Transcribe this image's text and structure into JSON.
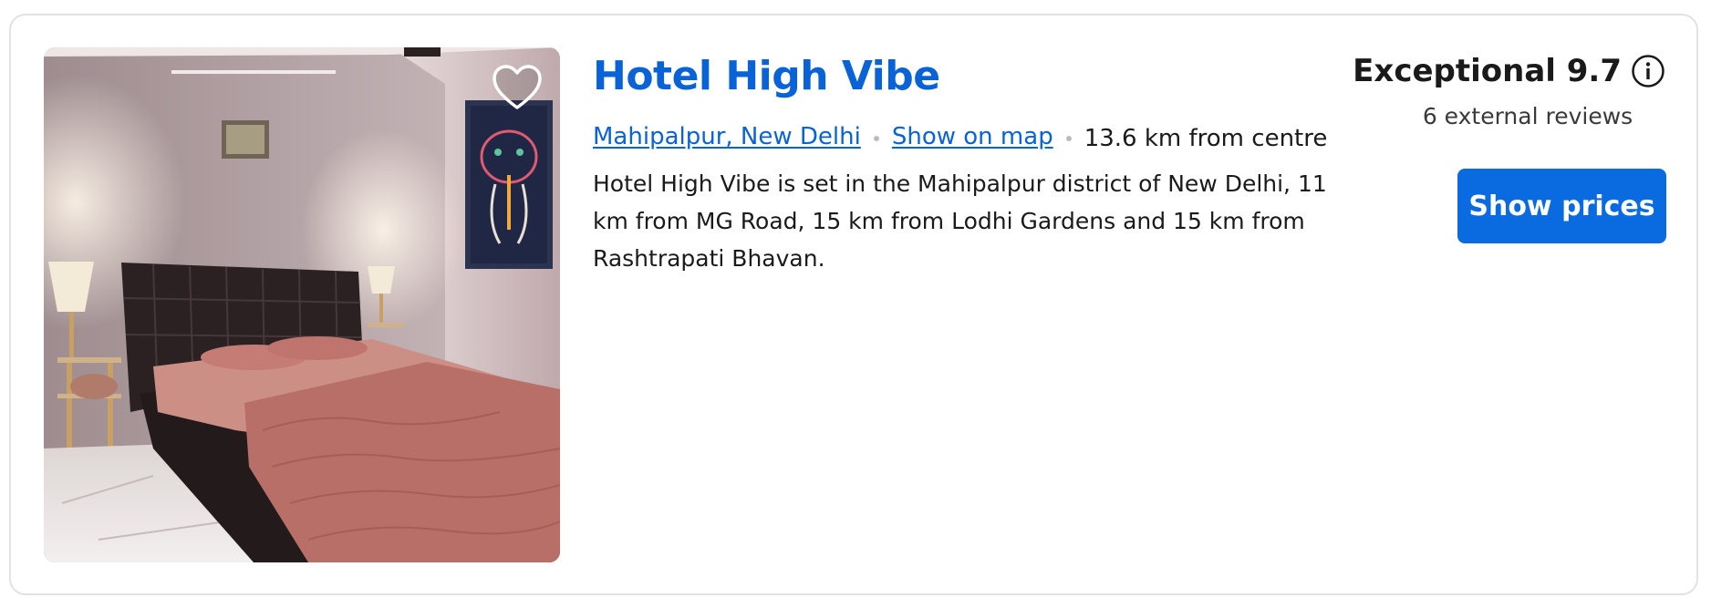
{
  "hotel": {
    "name": "Hotel High Vibe",
    "location_link": "Mahipalpur, New Delhi",
    "map_link": "Show on map",
    "distance": "13.6 km from centre",
    "description": "Hotel High Vibe is set in the Mahipalpur district of New Delhi, 11 km from MG Road, 15 km from Lodhi Gardens and 15 km from Rashtrapati Bhavan."
  },
  "rating": {
    "label": "Exceptional 9.7",
    "reviews": "6 external reviews"
  },
  "actions": {
    "show_prices": "Show prices"
  },
  "icons": {
    "favorite": "heart-outline-icon",
    "info": "info-circle-icon"
  },
  "colors": {
    "brand_blue": "#0a63d6",
    "button_blue": "#0a6ae0"
  }
}
